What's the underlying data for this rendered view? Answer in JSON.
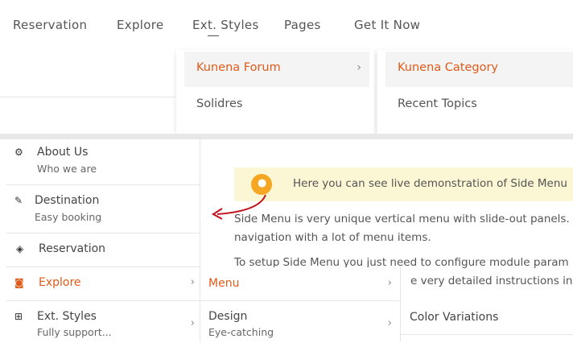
{
  "topnav": {
    "items": [
      {
        "label": "Reservation"
      },
      {
        "label": "Explore"
      },
      {
        "label": "Ext. Styles"
      },
      {
        "label": "Pages"
      },
      {
        "label": "Get It Now"
      }
    ],
    "active_index": 2
  },
  "dropdown_level1": {
    "items": [
      {
        "label": "Kunena Forum",
        "has_submenu": true,
        "highlighted": true
      },
      {
        "label": "Solidres"
      }
    ]
  },
  "dropdown_level2": {
    "items": [
      {
        "label": "Kunena Category",
        "highlighted": true
      },
      {
        "label": "Recent Topics"
      }
    ]
  },
  "sidemenu": {
    "items": [
      {
        "title": "About Us",
        "subtitle": "Who we are",
        "icon": "gear-icon"
      },
      {
        "title": "Destination",
        "subtitle": "Easy booking",
        "icon": "pin-icon"
      },
      {
        "title": "Reservation",
        "icon": "ticket-icon"
      },
      {
        "title": "Explore",
        "icon": "camera-icon",
        "active": true
      },
      {
        "title": "Ext. Styles",
        "subtitle": "Fully support...",
        "icon": "gift-icon"
      }
    ]
  },
  "panel_level1": {
    "items": [
      {
        "title": "Menu",
        "active": true
      },
      {
        "title": "Design",
        "subtitle": "Eye-catching"
      }
    ]
  },
  "panel_level2": {
    "items": [
      {
        "title": "Color Variations"
      }
    ]
  },
  "content": {
    "notice": "Here you can see live demonstration of Side Menu",
    "para1_line1": "Side Menu is very unique vertical menu with slide-out panels.",
    "para1_line2": "navigation with a lot of menu items.",
    "para2_line1": "To setup Side Menu you just need to configure module param",
    "para2_line2": "e very detailed instructions in te"
  },
  "colors": {
    "accent": "#e05a1a",
    "notice_bg": "#fbf6d3",
    "bulb": "#f5a623",
    "arrow": "#c0121b"
  }
}
